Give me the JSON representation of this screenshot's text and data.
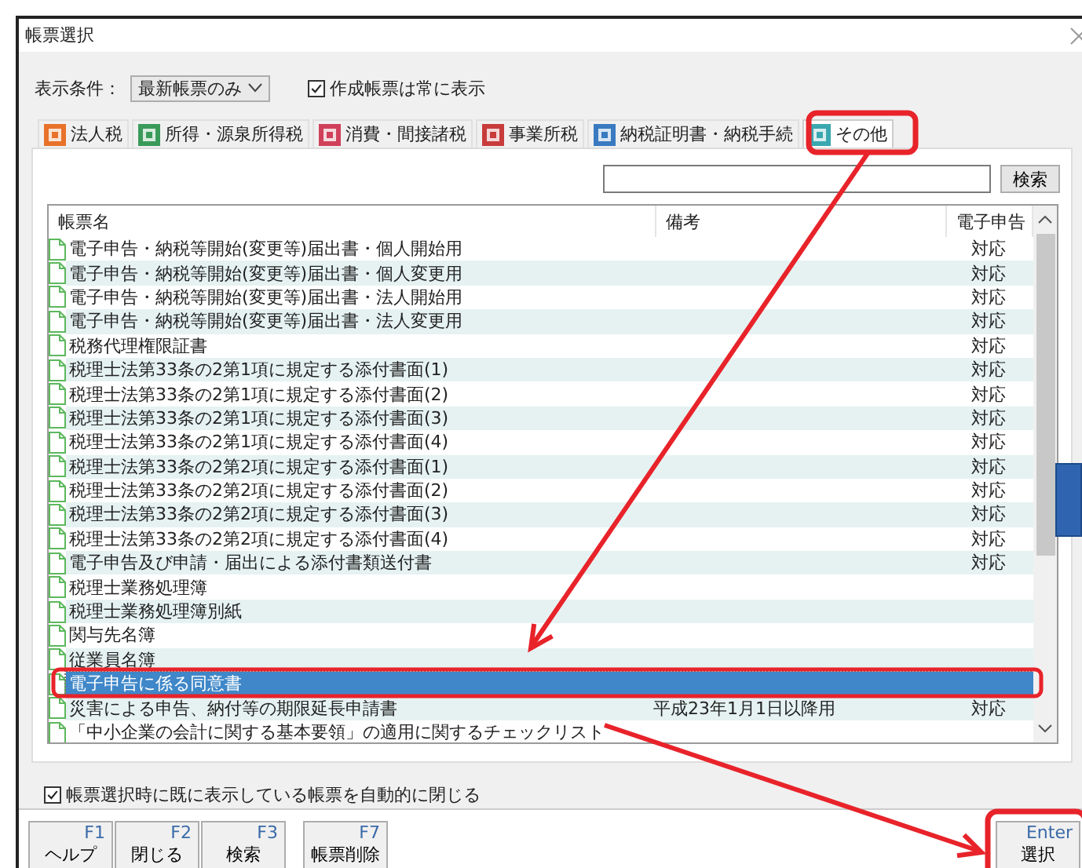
{
  "window": {
    "title": "帳票選択"
  },
  "filter": {
    "label": "表示条件：",
    "dropdown": "最新帳票のみ",
    "always_show": {
      "label": "作成帳票は常に表示",
      "checked": true
    }
  },
  "tabs": [
    {
      "label": "法人税",
      "selected": false,
      "color": "#e8722a"
    },
    {
      "label": "所得・源泉所得税",
      "selected": false,
      "color": "#3a9a5a"
    },
    {
      "label": "消費・間接諸税",
      "selected": false,
      "color": "#d0405a"
    },
    {
      "label": "事業所税",
      "selected": false,
      "color": "#c83c3c"
    },
    {
      "label": "納税証明書・納税手続",
      "selected": false,
      "color": "#3a7ac0"
    },
    {
      "label": "その他",
      "selected": true,
      "color": "#3aa8b0"
    }
  ],
  "search": {
    "button": "検索"
  },
  "table": {
    "columns": [
      "帳票名",
      "備考",
      "電子申告"
    ],
    "rows": [
      {
        "name": "電子申告・納税等開始(変更等)届出書・個人開始用",
        "e_filing": "対応",
        "selected": false
      },
      {
        "name": "電子申告・納税等開始(変更等)届出書・個人変更用",
        "e_filing": "対応",
        "selected": false
      },
      {
        "name": "電子申告・納税等開始(変更等)届出書・法人開始用",
        "e_filing": "対応",
        "selected": false
      },
      {
        "name": "電子申告・納税等開始(変更等)届出書・法人変更用",
        "e_filing": "対応",
        "selected": false
      },
      {
        "name": "税務代理権限証書",
        "e_filing": "対応",
        "selected": false
      },
      {
        "name": "税理士法第33条の2第1項に規定する添付書面(1)",
        "e_filing": "対応",
        "selected": false
      },
      {
        "name": "税理士法第33条の2第1項に規定する添付書面(2)",
        "e_filing": "対応",
        "selected": false
      },
      {
        "name": "税理士法第33条の2第1項に規定する添付書面(3)",
        "e_filing": "対応",
        "selected": false
      },
      {
        "name": "税理士法第33条の2第1項に規定する添付書面(4)",
        "e_filing": "対応",
        "selected": false
      },
      {
        "name": "税理士法第33条の2第2項に規定する添付書面(1)",
        "e_filing": "対応",
        "selected": false
      },
      {
        "name": "税理士法第33条の2第2項に規定する添付書面(2)",
        "e_filing": "対応",
        "selected": false
      },
      {
        "name": "税理士法第33条の2第2項に規定する添付書面(3)",
        "e_filing": "対応",
        "selected": false
      },
      {
        "name": "税理士法第33条の2第2項に規定する添付書面(4)",
        "e_filing": "対応",
        "selected": false
      },
      {
        "name": "電子申告及び申請・届出による添付書類送付書",
        "e_filing": "対応",
        "selected": false
      },
      {
        "name": "税理士業務処理簿",
        "selected": false
      },
      {
        "name": "税理士業務処理簿別紙",
        "selected": false
      },
      {
        "name": "関与先名簿",
        "selected": false
      },
      {
        "name": "従業員名簿",
        "selected": false
      },
      {
        "name": "電子申告に係る同意書",
        "selected": true
      },
      {
        "name": "災害による申告、納付等の期限延長申請書",
        "remark": "平成23年1月1日以降用",
        "e_filing": "対応",
        "selected": false
      },
      {
        "name": "「中小企業の会計に関する基本要領」の適用に関するチェックリスト",
        "selected": false
      }
    ]
  },
  "auto_close": {
    "label": "帳票選択時に既に表示している帳票を自動的に閉じる",
    "checked": true
  },
  "function_keys_left": [
    {
      "key": "F1",
      "label": "ヘルプ"
    },
    {
      "key": "F2",
      "label": "閉じる"
    },
    {
      "key": "F3",
      "label": "検索"
    }
  ],
  "function_keys_mid": [
    {
      "key": "F7",
      "label": "帳票削除"
    }
  ],
  "enter_button": {
    "key": "Enter",
    "label": "選択"
  }
}
